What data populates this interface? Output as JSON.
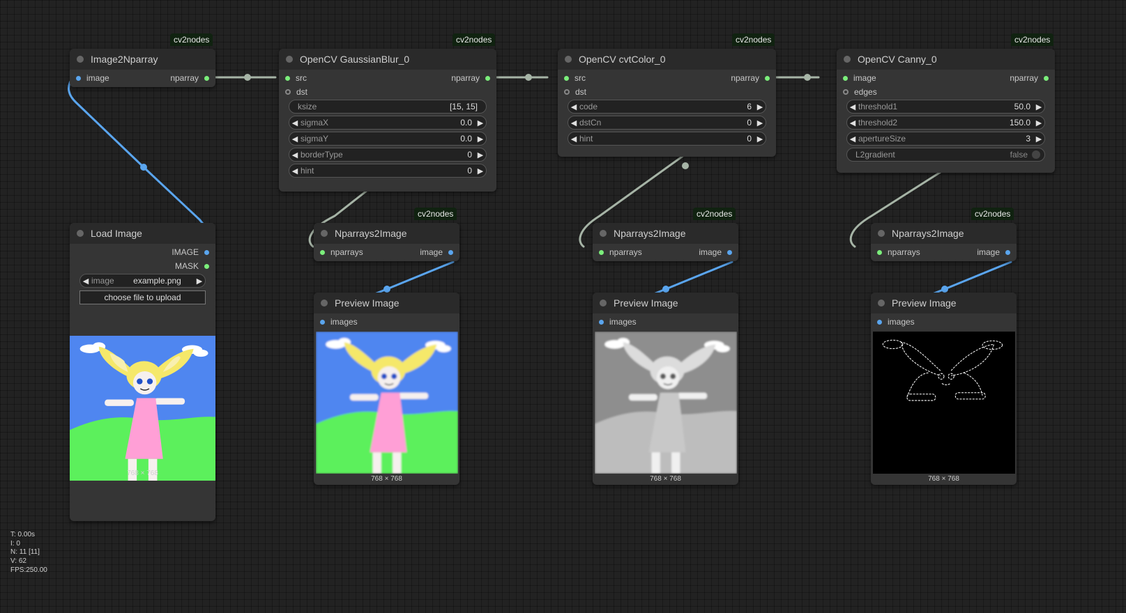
{
  "badge": "cv2nodes",
  "nodes": {
    "image2nparray": {
      "title": "Image2Nparray",
      "in": "image",
      "out": "nparray"
    },
    "gaussian": {
      "title": "OpenCV GaussianBlur_0",
      "in1": "src",
      "in2": "dst",
      "out": "nparray",
      "widgets": [
        {
          "label": "ksize",
          "value": "[15, 15]"
        },
        {
          "label": "sigmaX",
          "value": "0.0"
        },
        {
          "label": "sigmaY",
          "value": "0.0"
        },
        {
          "label": "borderType",
          "value": "0"
        },
        {
          "label": "hint",
          "value": "0"
        }
      ]
    },
    "cvtcolor": {
      "title": "OpenCV cvtColor_0",
      "in1": "src",
      "in2": "dst",
      "out": "nparray",
      "widgets": [
        {
          "label": "code",
          "value": "6"
        },
        {
          "label": "dstCn",
          "value": "0"
        },
        {
          "label": "hint",
          "value": "0"
        }
      ]
    },
    "canny": {
      "title": "OpenCV Canny_0",
      "in1": "image",
      "in2": "edges",
      "out": "nparray",
      "widgets": [
        {
          "label": "threshold1",
          "value": "50.0"
        },
        {
          "label": "threshold2",
          "value": "150.0"
        },
        {
          "label": "apertureSize",
          "value": "3"
        },
        {
          "label": "L2gradient",
          "value": "false"
        }
      ]
    },
    "load_image": {
      "title": "Load Image",
      "out1": "IMAGE",
      "out2": "MASK",
      "widget_label": "image",
      "widget_value": "example.png",
      "upload_button": "choose file to upload",
      "dims": "768 × 768"
    },
    "nparrays2image": {
      "title": "Nparrays2Image",
      "in": "nparrays",
      "out": "image"
    },
    "preview": {
      "title": "Preview Image",
      "in": "images",
      "dims": "768 × 768"
    }
  },
  "stats": {
    "t": "T: 0.00s",
    "i": "I: 0",
    "n": "N: 11 [11]",
    "v": "V: 62",
    "fps": "FPS:250.00"
  },
  "colors": {
    "canvas": "#222222",
    "node_body": "#353535",
    "node_title": "#2a2a2a",
    "badge_bg": "#102210",
    "image_link": "#5aa5ee",
    "nparray_link": "#a6b4a6",
    "slot_image": "#5aa5ee",
    "slot_nparray": "#7bee7b"
  },
  "icons": {
    "title_dot": "circle-dot",
    "widget_left": "triangle-left-icon",
    "widget_right": "triangle-right-icon"
  }
}
